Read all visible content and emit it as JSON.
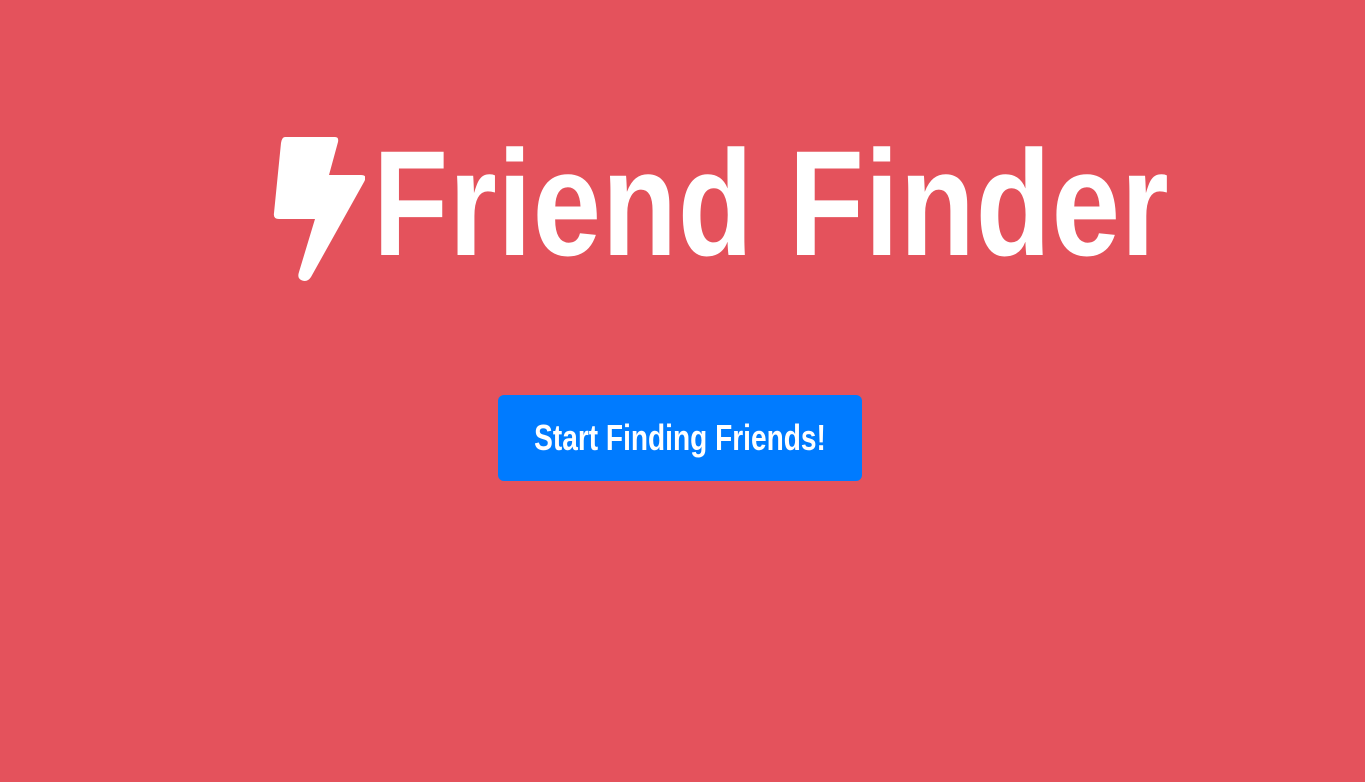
{
  "hero": {
    "icon": "lightning-bolt-icon",
    "title": "Friend Finder"
  },
  "cta": {
    "label": "Start Finding Friends!"
  },
  "colors": {
    "background": "#e4525c",
    "button": "#007bff",
    "text": "#ffffff"
  }
}
